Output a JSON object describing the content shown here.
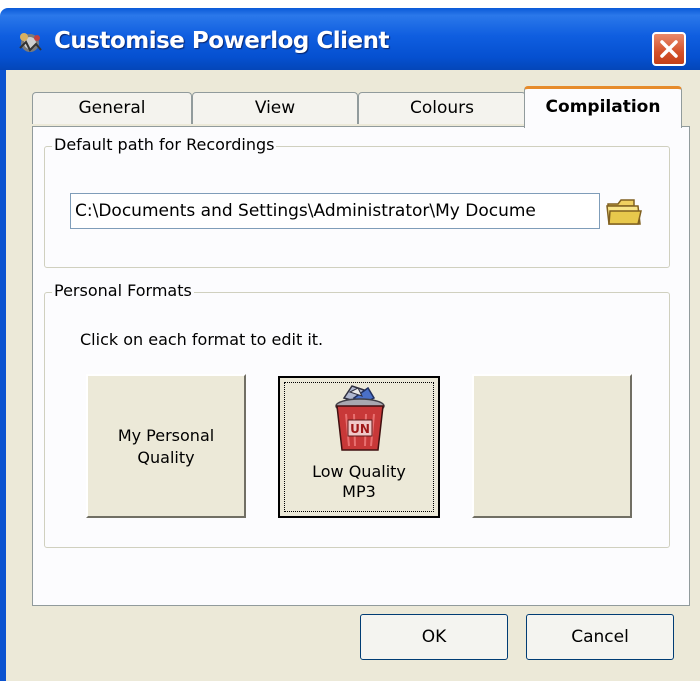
{
  "window": {
    "title": "Customise Powerlog Client",
    "icons": {
      "app": "powerlog-app-icon",
      "close": "close-icon"
    },
    "colors": {
      "titlebar": "#0550d0",
      "close": "#d4512a",
      "client_bg": "#ece9d8",
      "active_tab_accent": "#e68b2c"
    }
  },
  "tabs": [
    {
      "label": "General",
      "active": false
    },
    {
      "label": "View",
      "active": false
    },
    {
      "label": "Colours",
      "active": false
    },
    {
      "label": "Compilation",
      "active": true
    }
  ],
  "recordings": {
    "group_label": "Default path for Recordings",
    "path_value": "C:\\Documents and Settings\\Administrator\\My Docume",
    "browse_icon": "folder-icon"
  },
  "formats": {
    "group_label": "Personal Formats",
    "hint": "Click on each format to edit it.",
    "buttons": [
      {
        "line1": "My Personal",
        "line2": "Quality",
        "selected": false
      },
      {
        "line1": "Low Quality",
        "line2": "MP3",
        "selected": true,
        "icon": "trash-bin-icon"
      },
      {
        "line1": "",
        "line2": "",
        "selected": false
      }
    ]
  },
  "footer": {
    "ok_label": "OK",
    "cancel_label": "Cancel"
  }
}
